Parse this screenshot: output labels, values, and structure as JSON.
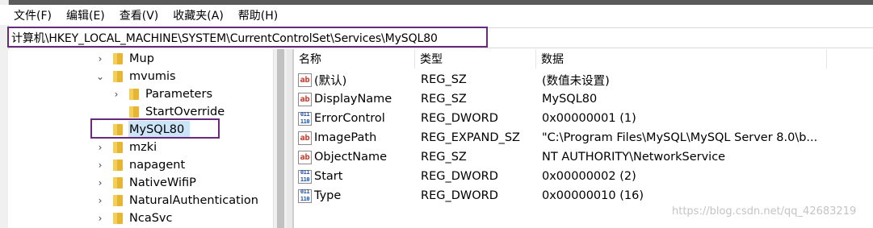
{
  "menu": [
    "文件(F)",
    "编辑(E)",
    "查看(V)",
    "收藏夹(A)",
    "帮助(H)"
  ],
  "address": "计算机\\HKEY_LOCAL_MACHINE\\SYSTEM\\CurrentControlSet\\Services\\MySQL80",
  "tree": [
    {
      "label": "Mup",
      "chevron": "›",
      "indent": 0
    },
    {
      "label": "mvumis",
      "chevron": "⌄",
      "indent": 0
    },
    {
      "label": "Parameters",
      "chevron": "›",
      "indent": 1
    },
    {
      "label": "StartOverride",
      "chevron": "",
      "indent": 1
    },
    {
      "label": "MySQL80",
      "chevron": "",
      "indent": 0,
      "selected": true
    },
    {
      "label": "mzki",
      "chevron": "›",
      "indent": 0
    },
    {
      "label": "napagent",
      "chevron": "›",
      "indent": 0
    },
    {
      "label": "NativeWifiP",
      "chevron": "›",
      "indent": 0
    },
    {
      "label": "NaturalAuthentication",
      "chevron": "›",
      "indent": 0
    },
    {
      "label": "NcaSvc",
      "chevron": "›",
      "indent": 0
    }
  ],
  "columns": [
    "名称",
    "类型",
    "数据"
  ],
  "values": [
    {
      "icon": "ab",
      "name": "(默认)",
      "type": "REG_SZ",
      "data": "(数值未设置)"
    },
    {
      "icon": "ab",
      "name": "DisplayName",
      "type": "REG_SZ",
      "data": "MySQL80"
    },
    {
      "icon": "bin",
      "name": "ErrorControl",
      "type": "REG_DWORD",
      "data": "0x00000001 (1)"
    },
    {
      "icon": "ab",
      "name": "ImagePath",
      "type": "REG_EXPAND_SZ",
      "data": "\"C:\\Program Files\\MySQL\\MySQL Server 8.0\\b..."
    },
    {
      "icon": "ab",
      "name": "ObjectName",
      "type": "REG_SZ",
      "data": "NT AUTHORITY\\NetworkService"
    },
    {
      "icon": "bin",
      "name": "Start",
      "type": "REG_DWORD",
      "data": "0x00000002 (2)"
    },
    {
      "icon": "bin",
      "name": "Type",
      "type": "REG_DWORD",
      "data": "0x00000010 (16)"
    }
  ],
  "watermark": "https://blog.csdn.net/qq_42683219",
  "colors": {
    "highlight_box": "#6a2a7a",
    "selection": "#cce4f7",
    "folder": "#e8b530"
  }
}
